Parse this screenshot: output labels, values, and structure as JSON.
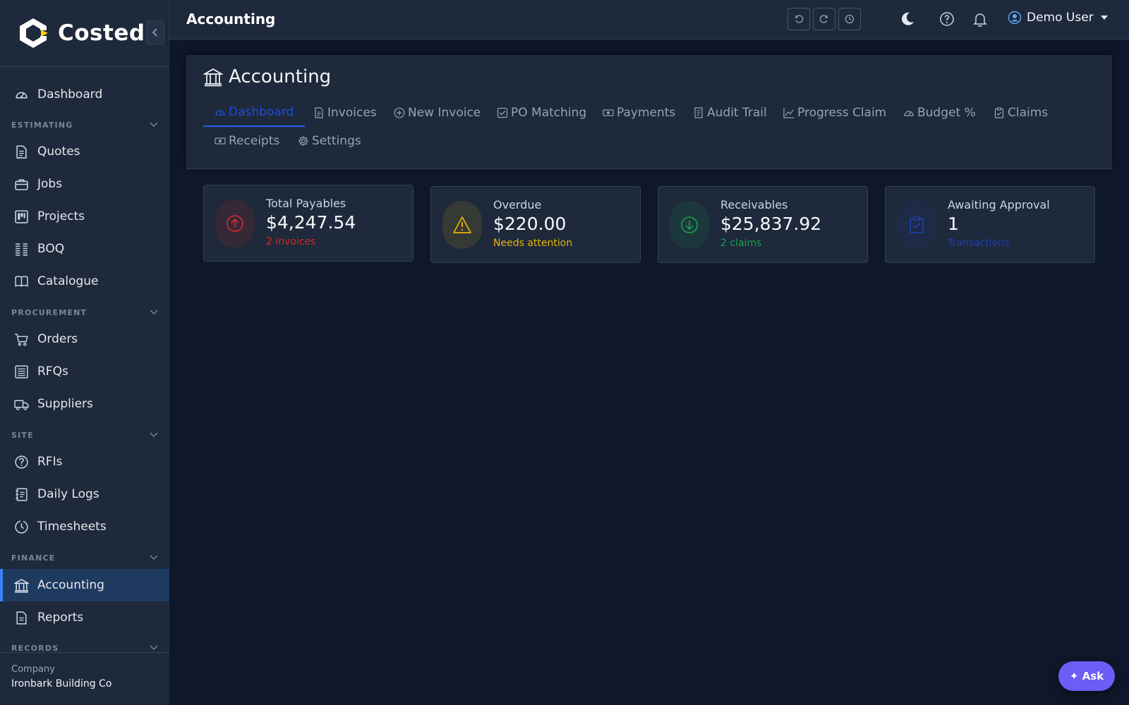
{
  "brand": {
    "name": "Costed"
  },
  "sidebar": {
    "items": [
      {
        "key": "dashboard",
        "label": "Dashboard",
        "icon": "gauge-icon"
      },
      {
        "key": "quotes",
        "label": "Quotes",
        "icon": "document-icon"
      },
      {
        "key": "jobs",
        "label": "Jobs",
        "icon": "briefcase-icon"
      },
      {
        "key": "projects",
        "label": "Projects",
        "icon": "kanban-icon"
      },
      {
        "key": "boq",
        "label": "BOQ",
        "icon": "list-columns-icon"
      },
      {
        "key": "catalogue",
        "label": "Catalogue",
        "icon": "book-icon"
      },
      {
        "key": "orders",
        "label": "Orders",
        "icon": "cart-icon"
      },
      {
        "key": "rfqs",
        "label": "RFQs",
        "icon": "newspaper-icon"
      },
      {
        "key": "suppliers",
        "label": "Suppliers",
        "icon": "truck-icon"
      },
      {
        "key": "rfis",
        "label": "RFIs",
        "icon": "question-circle-icon"
      },
      {
        "key": "daily-logs",
        "label": "Daily Logs",
        "icon": "journal-icon"
      },
      {
        "key": "timesheets",
        "label": "Timesheets",
        "icon": "clock-icon"
      },
      {
        "key": "accounting",
        "label": "Accounting",
        "icon": "bank-icon",
        "active": true
      },
      {
        "key": "reports",
        "label": "Reports",
        "icon": "report-icon"
      }
    ],
    "sections": {
      "estimating": "ESTIMATING",
      "procurement": "PROCUREMENT",
      "site": "SITE",
      "finance": "FINANCE",
      "records": "RECORDS"
    },
    "company": {
      "label": "Company",
      "name": "Ironbark Building Co"
    }
  },
  "topbar": {
    "title": "Accounting",
    "user": "Demo User"
  },
  "page": {
    "title": "Accounting",
    "tabs": [
      {
        "label": "Dashboard",
        "icon": "speedometer-icon",
        "active": true
      },
      {
        "label": "Invoices",
        "icon": "file-text-icon"
      },
      {
        "label": "New Invoice",
        "icon": "plus-circle-icon"
      },
      {
        "label": "PO Matching",
        "icon": "check-square-icon"
      },
      {
        "label": "Payments",
        "icon": "cash-icon"
      },
      {
        "label": "Audit Trail",
        "icon": "receipt-icon"
      },
      {
        "label": "Progress Claim",
        "icon": "graph-up-icon"
      },
      {
        "label": "Budget %",
        "icon": "speedometer-icon"
      },
      {
        "label": "Claims",
        "icon": "clipboard-check-icon"
      },
      {
        "label": "Receipts",
        "icon": "cash-icon"
      },
      {
        "label": "Settings",
        "icon": "gear-icon"
      }
    ]
  },
  "cards": [
    {
      "label": "Total Payables",
      "value": "$4,247.54",
      "sub": "2 invoices",
      "icon": "arrow-up-circle-icon",
      "color": "#dc2626"
    },
    {
      "label": "Overdue",
      "value": "$220.00",
      "sub": "Needs attention",
      "icon": "warning-icon",
      "color": "#eab308"
    },
    {
      "label": "Receivables",
      "value": "$25,837.92",
      "sub": "2 claims",
      "icon": "arrow-down-circle-icon",
      "color": "#16a34a"
    },
    {
      "label": "Awaiting Approval",
      "value": "1",
      "sub": "Transactions",
      "icon": "clipboard-check-icon",
      "color": "#1e40af"
    }
  ],
  "ask": {
    "label": "✦ Ask"
  }
}
